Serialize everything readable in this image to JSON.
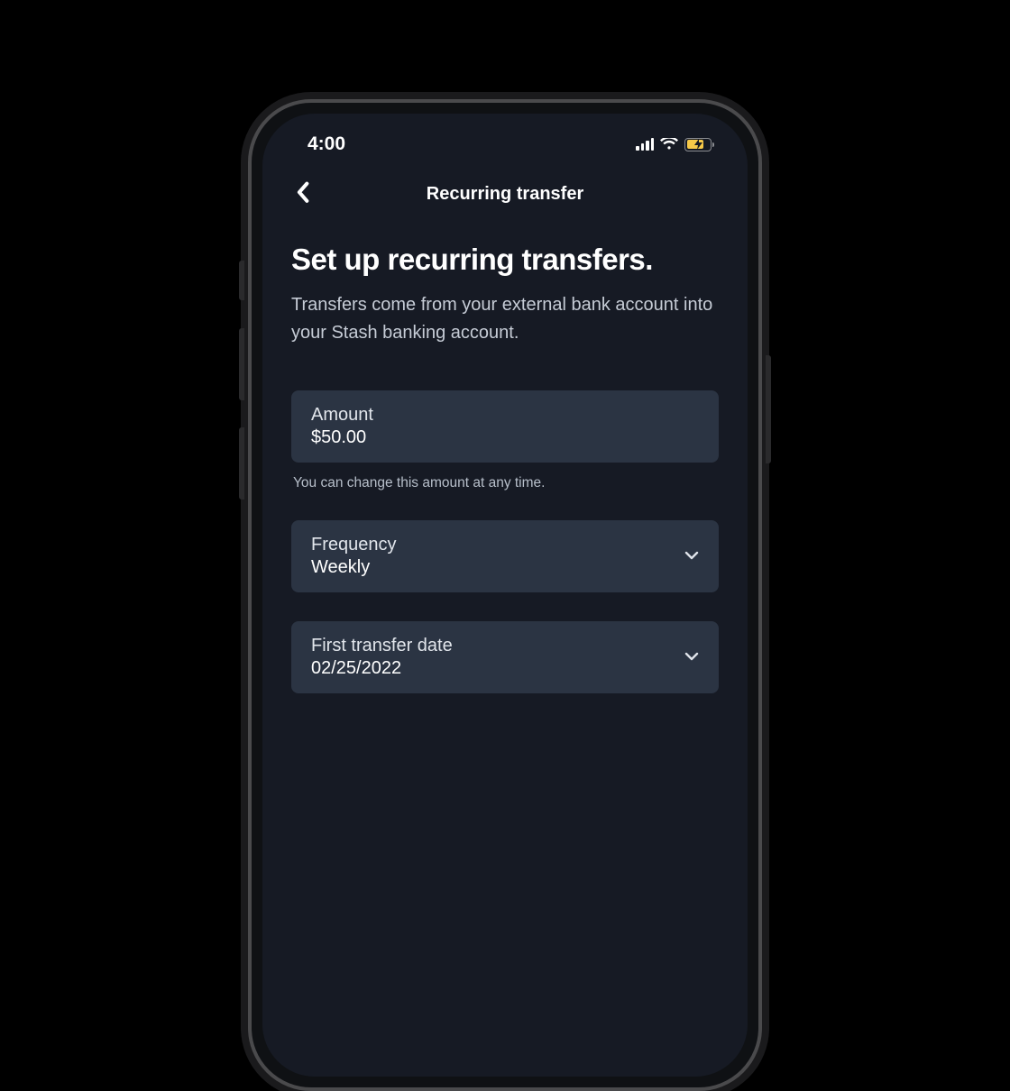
{
  "status": {
    "time": "4:00"
  },
  "nav": {
    "title": "Recurring transfer"
  },
  "page": {
    "heading": "Set up recurring transfers.",
    "subheading": "Transfers come from your external bank account into your Stash banking account."
  },
  "fields": {
    "amount": {
      "label": "Amount",
      "value": "$50.00",
      "helper": "You can change this amount at any time."
    },
    "frequency": {
      "label": "Frequency",
      "value": "Weekly"
    },
    "first_date": {
      "label": "First transfer date",
      "value": "02/25/2022"
    }
  }
}
